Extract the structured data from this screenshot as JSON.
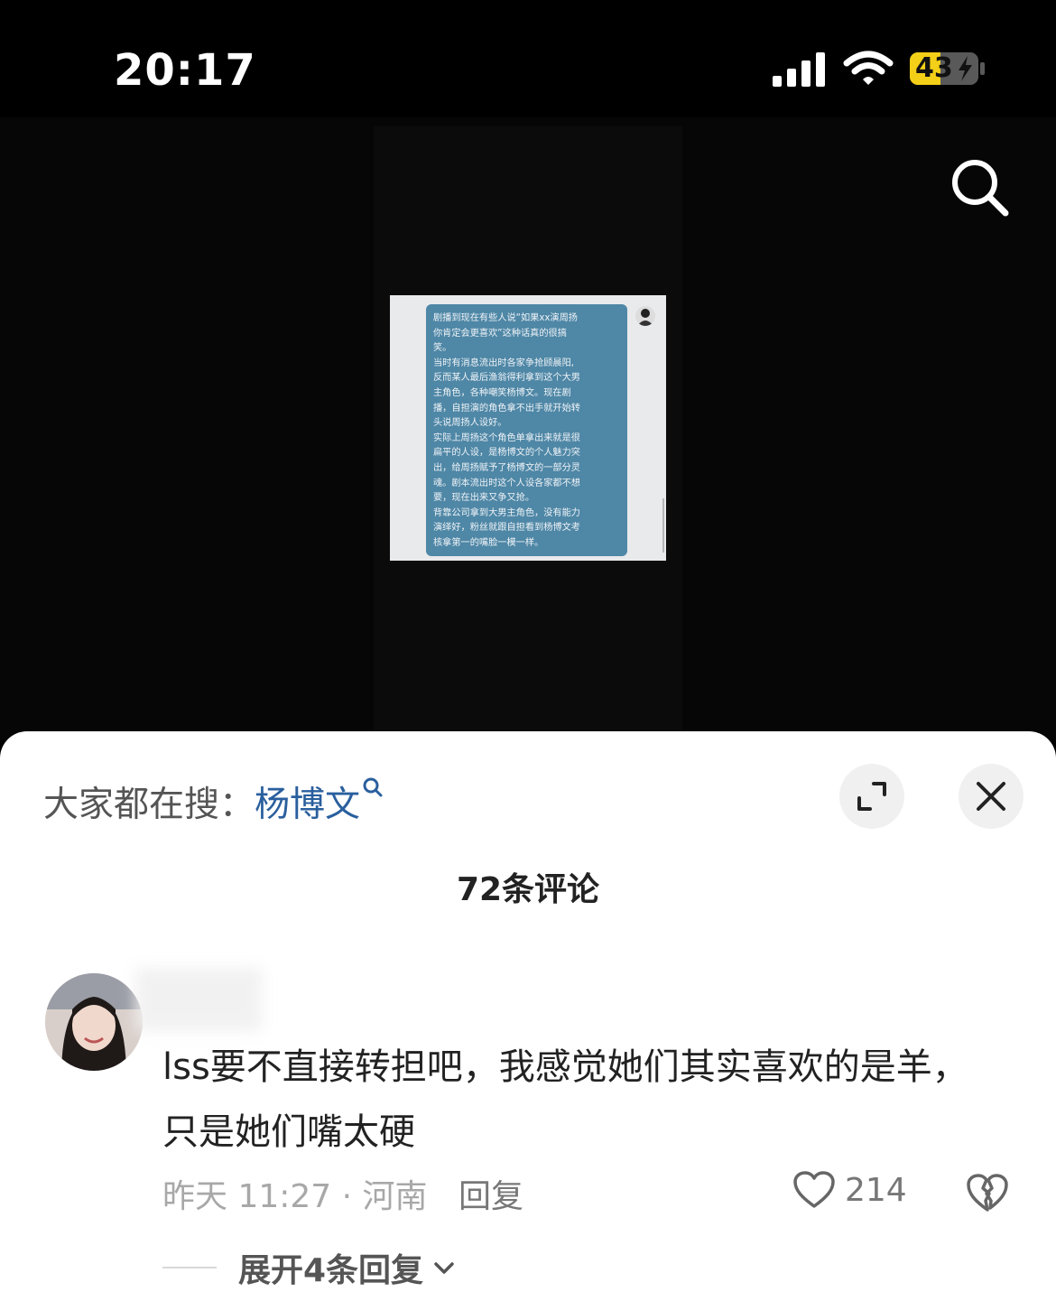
{
  "status_bar": {
    "time": "20:17",
    "battery": "43",
    "battery_color": "#f4cf18"
  },
  "video": {
    "screenshot_text": "剧播到现在有些人说“如果xx演周扬\n你肯定会更喜欢”这种话真的很搞\n笑。\n当时有消息流出时各家争抢顾晨阳,\n反而某人最后渔翁得利拿到这个大男\n主角色，各种嘲笑杨博文。现在剧\n播，自担演的角色拿不出手就开始转\n头说周扬人设好。\n实际上周扬这个角色单拿出来就是很\n扁平的人设，是杨博文的个人魅力突\n出，给周扬赋予了杨博文的一部分灵\n魂。剧本流出时这个人设各家都不想\n要，现在出来又争又抢。\n背靠公司拿到大男主角色，没有能力\n演绎好，粉丝就跟自担看到杨博文考\n核拿第一的嘴脸一模一样。",
    "bubble_color": "#4f87a6"
  },
  "comments_sheet": {
    "trending_prefix": "大家都在搜：",
    "trending_keyword": "杨博文",
    "keyword_color": "#2a5f9e",
    "comment_count": "72条评论",
    "comments": [
      {
        "text": "lss要不直接转担吧，我感觉她们其实喜欢的是羊，只是她们嘴太硬",
        "meta": "昨天 11:27 · 河南",
        "reply_label": "回复",
        "likes": "214",
        "expand_label": "展开4条回复"
      }
    ]
  },
  "icons": {
    "search": "search-icon",
    "expand": "expand-icon",
    "close": "close-icon",
    "like": "heart-icon",
    "dislike": "broken-heart-icon",
    "chevron": "chevron-down-icon"
  }
}
